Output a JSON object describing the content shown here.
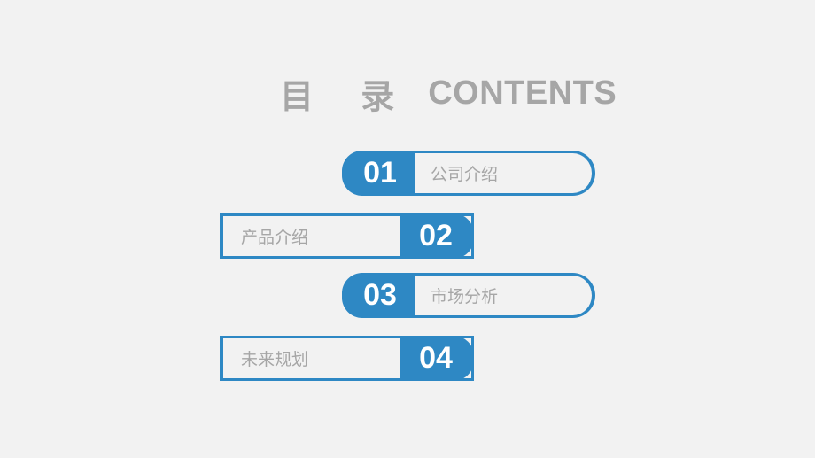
{
  "title": {
    "cn": "目 录",
    "en": "CONTENTS"
  },
  "accent_color": "#2e88c4",
  "items": [
    {
      "number": "01",
      "label": "公司介绍"
    },
    {
      "number": "02",
      "label": "产品介绍"
    },
    {
      "number": "03",
      "label": "市场分析"
    },
    {
      "number": "04",
      "label": "未来规划"
    }
  ]
}
